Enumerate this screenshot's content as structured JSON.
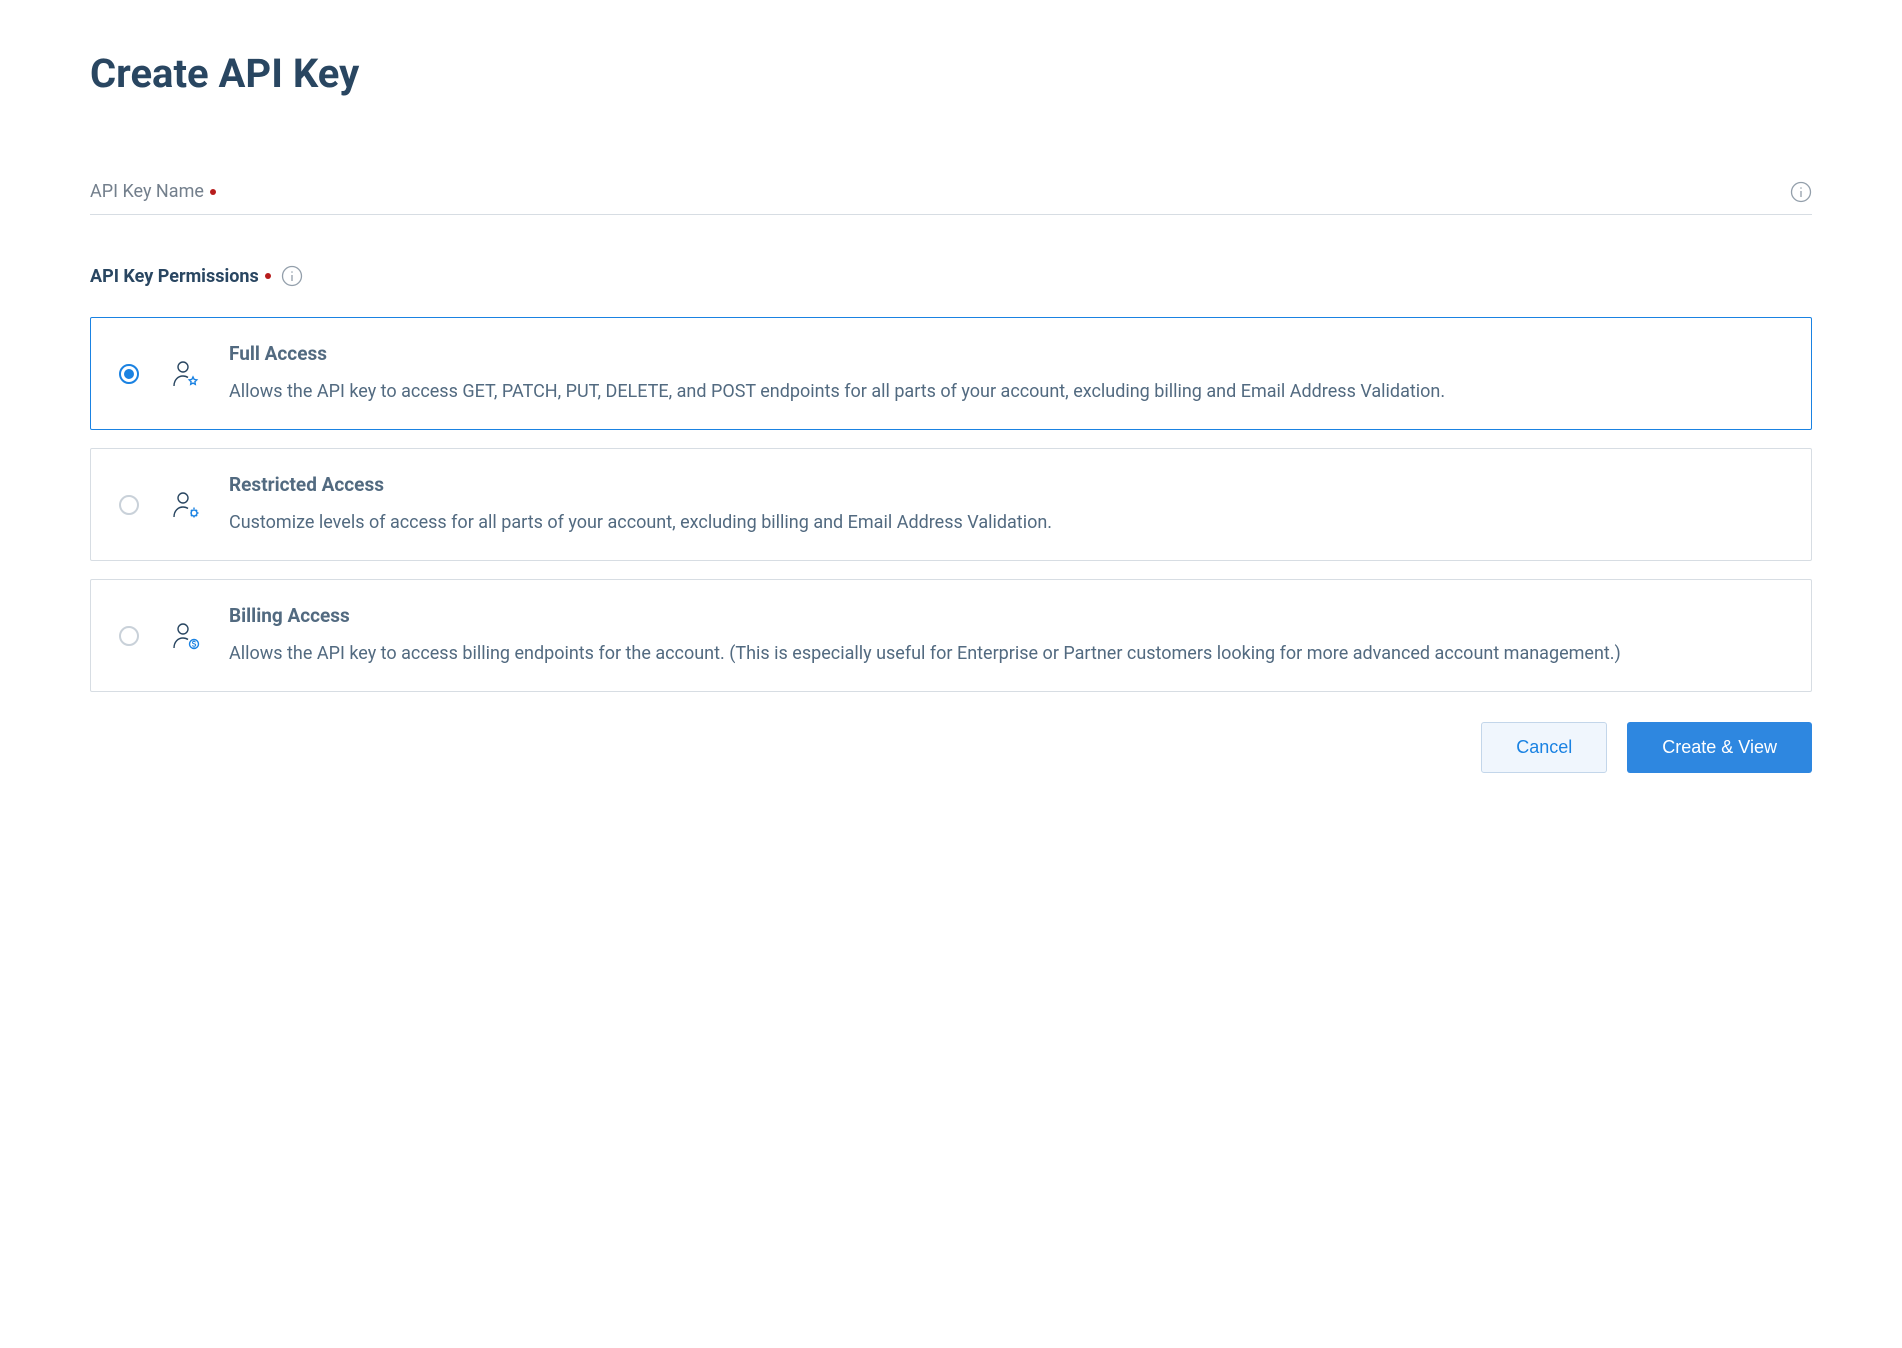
{
  "page": {
    "title": "Create API Key"
  },
  "form": {
    "name_field": {
      "label": "API Key Name",
      "value": ""
    },
    "permissions": {
      "label": "API Key Permissions",
      "options": [
        {
          "title": "Full Access",
          "description": "Allows the API key to access GET, PATCH, PUT, DELETE, and POST endpoints for all parts of your account, excluding billing and Email Address Validation.",
          "selected": true,
          "icon": "user-star"
        },
        {
          "title": "Restricted Access",
          "description": "Customize levels of access for all parts of your account, excluding billing and Email Address Validation.",
          "selected": false,
          "icon": "user-gear"
        },
        {
          "title": "Billing Access",
          "description": "Allows the API key to access billing endpoints for the account. (This is especially useful for Enterprise or Partner customers looking for more advanced account management.)",
          "selected": false,
          "icon": "user-dollar"
        }
      ]
    }
  },
  "actions": {
    "cancel": "Cancel",
    "create": "Create & View"
  }
}
